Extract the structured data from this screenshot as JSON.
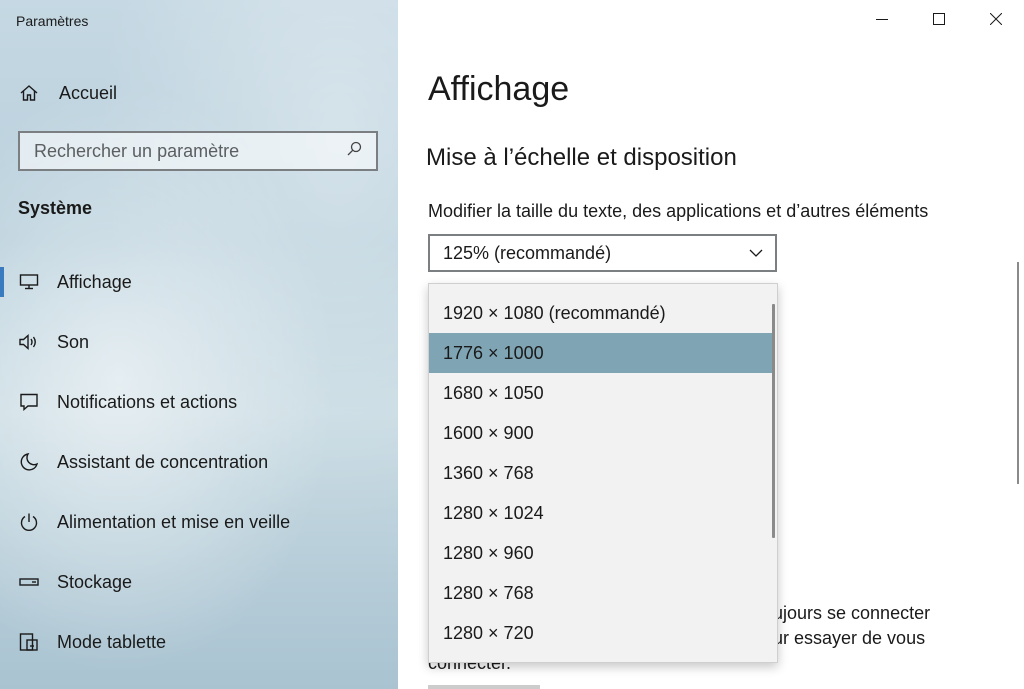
{
  "window": {
    "title": "Paramètres",
    "controls": [
      "minimize-icon",
      "maximize-icon",
      "close-icon"
    ]
  },
  "sidebar": {
    "home_label": "Accueil",
    "search_placeholder": "Rechercher un paramètre",
    "section": "Système",
    "active_color": "#3a7bbf",
    "items": [
      {
        "label": "Affichage",
        "icon": "monitor-icon"
      },
      {
        "label": "Son",
        "icon": "speaker-icon"
      },
      {
        "label": "Notifications et actions",
        "icon": "notification-icon"
      },
      {
        "label": "Assistant de concentration",
        "icon": "moon-icon"
      },
      {
        "label": "Alimentation et mise en veille",
        "icon": "power-icon"
      },
      {
        "label": "Stockage",
        "icon": "storage-icon"
      },
      {
        "label": "Mode tablette",
        "icon": "tablet-icon"
      }
    ]
  },
  "main": {
    "title": "Affichage",
    "subtitle": "Mise à l’échelle et disposition",
    "scale_label": "Modifier la taille du texte, des applications et d’autres éléments",
    "scale_value": "125% (recommandé)",
    "bg_text": {
      "line1": "ujours se connecter",
      "line2": "ur essayer de vous",
      "line3": "connecter."
    }
  },
  "dropdown": {
    "selected_color": "#7fa5b4",
    "selected_index": 1,
    "options": [
      "1920 × 1080 (recommandé)",
      "1776 × 1000",
      "1680 × 1050",
      "1600 × 900",
      "1360 × 768",
      "1280 × 1024",
      "1280 × 960",
      "1280 × 768",
      "1280 × 720"
    ]
  }
}
